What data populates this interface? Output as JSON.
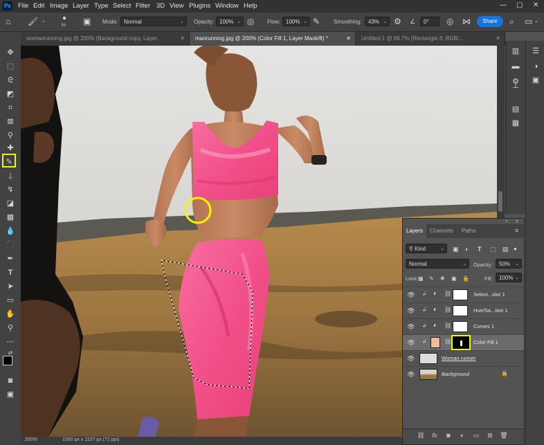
{
  "menu": [
    "File",
    "Edit",
    "Image",
    "Layer",
    "Type",
    "Select",
    "Filter",
    "3D",
    "View",
    "Plugins",
    "Window",
    "Help"
  ],
  "app_badge": "Ps",
  "options": {
    "brush_size": "36",
    "mode_label": "Mode:",
    "mode_value": "Normal",
    "opacity_label": "Opacity:",
    "opacity_value": "100%",
    "flow_label": "Flow:",
    "flow_value": "100%",
    "smoothing_label": "Smoothing:",
    "smoothing_value": "43%",
    "angle_value": "0°",
    "share_label": "Share"
  },
  "tabs": [
    {
      "label": "womanrunning.jpg @ 200% (Background copy, Layer...",
      "active": false
    },
    {
      "label": "manrunning.jpg @ 200% (Color Fill 1, Layer Mask/8) *",
      "active": true
    },
    {
      "label": "Untitled-1 @ 66.7% (Rectangle 3, RGB/...",
      "active": false
    }
  ],
  "status": {
    "zoom": "200%",
    "doc": "1500 px x 1107 px (72 ppi)"
  },
  "layers_panel": {
    "tabs": [
      "Layers",
      "Channels",
      "Paths"
    ],
    "filter_kind": "Kind",
    "blend_mode": "Normal",
    "opacity_label": "Opacity:",
    "opacity_value": "50%",
    "lock_label": "Lock:",
    "fill_label": "Fill:",
    "fill_value": "100%",
    "layers": [
      {
        "name": "Select...olor 1",
        "selected": false
      },
      {
        "name": "Hue/Sa...tion 1",
        "selected": false
      },
      {
        "name": "Curves 1",
        "selected": false
      },
      {
        "name": "Color Fill 1",
        "selected": true
      },
      {
        "name": "Woman runner",
        "selected": false
      },
      {
        "name": "Background",
        "selected": false
      }
    ]
  },
  "colors": {
    "accent": "#1473e6",
    "highlight": "#f5f500",
    "color_fill_swatch": "#f4b89a"
  }
}
